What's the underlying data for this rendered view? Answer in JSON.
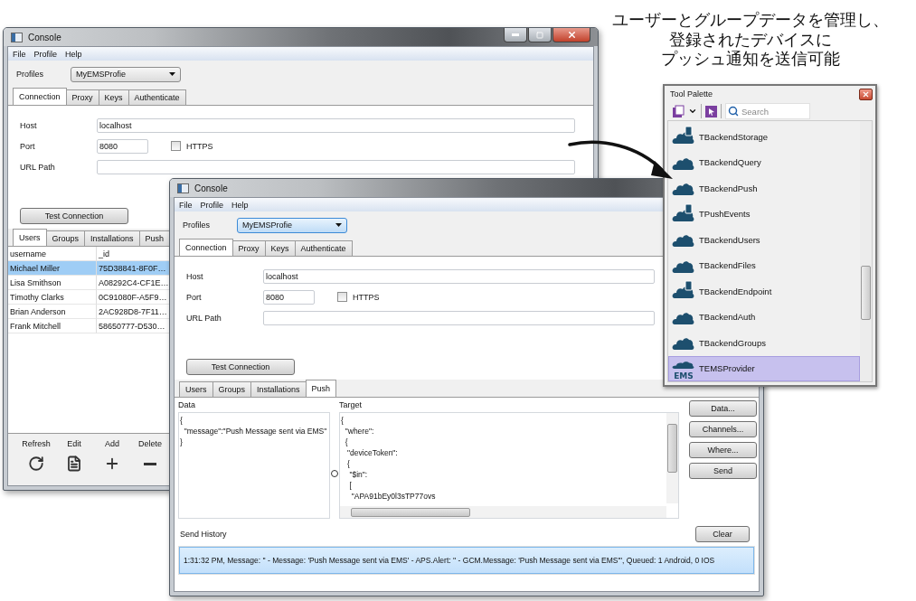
{
  "annotation": {
    "lines": [
      "ユーザーとグループデータを管理し、",
      "登録されたデバイスに",
      "プッシュ通知を送信可能"
    ]
  },
  "back_window": {
    "title": "Console",
    "menu": [
      "File",
      "Profile",
      "Help"
    ],
    "profiles": {
      "label": "Profiles",
      "value": "MyEMSProfie"
    },
    "tabs": [
      {
        "label": "Connection",
        "selected": true
      },
      {
        "label": "Proxy",
        "selected": false
      },
      {
        "label": "Keys",
        "selected": false
      },
      {
        "label": "Authenticate",
        "selected": false
      }
    ],
    "host": {
      "label": "Host",
      "value": "localhost"
    },
    "port": {
      "label": "Port",
      "value": "8080"
    },
    "https": {
      "label": "HTTPS",
      "checked": false
    },
    "url_path": {
      "label": "URL Path"
    },
    "test_button": "Test Connection",
    "data_tabs": [
      {
        "label": "Users",
        "selected": true
      },
      {
        "label": "Groups",
        "selected": false
      },
      {
        "label": "Installations",
        "selected": false
      },
      {
        "label": "Push",
        "selected": false
      }
    ],
    "table": {
      "columns": [
        "username",
        "_id"
      ],
      "rows": [
        {
          "cells": [
            "Michael Miller",
            "75D38841-8F0F…"
          ],
          "selected": true
        },
        {
          "cells": [
            "Lisa Smithson",
            "A08292C4-CF1E…"
          ],
          "selected": false
        },
        {
          "cells": [
            "Timothy Clarks",
            "0C91080F-A5F9…"
          ],
          "selected": false
        },
        {
          "cells": [
            "Brian Anderson",
            "2AC928D8-7F11…"
          ],
          "selected": false
        },
        {
          "cells": [
            "Frank Mitchell",
            "58650777-D530…"
          ],
          "selected": false
        }
      ]
    },
    "toolbar": [
      {
        "kind": "refresh",
        "label": "Refresh"
      },
      {
        "kind": "edit",
        "label": "Edit"
      },
      {
        "kind": "add",
        "label": "Add"
      },
      {
        "kind": "delete",
        "label": "Delete"
      }
    ]
  },
  "front_window": {
    "title": "Console",
    "menu": [
      "File",
      "Profile",
      "Help"
    ],
    "profiles": {
      "label": "Profiles",
      "value": "MyEMSProfie",
      "focused": true
    },
    "tabs": [
      {
        "label": "Connection",
        "selected": true
      },
      {
        "label": "Proxy",
        "selected": false
      },
      {
        "label": "Keys",
        "selected": false
      },
      {
        "label": "Authenticate",
        "selected": false
      }
    ],
    "host": {
      "label": "Host",
      "value": "localhost"
    },
    "port": {
      "label": "Port",
      "value": "8080"
    },
    "https": {
      "label": "HTTPS",
      "checked": false
    },
    "url_path": {
      "label": "URL Path"
    },
    "test_button": "Test Connection",
    "data_tabs": [
      {
        "label": "Users",
        "selected": false
      },
      {
        "label": "Groups",
        "selected": false
      },
      {
        "label": "Installations",
        "selected": false
      },
      {
        "label": "Push",
        "selected": true
      }
    ],
    "push": {
      "data_label": "Data",
      "data_text": "{\n  \"message\":\"Push Message sent via EMS\"\n}",
      "target_label": "Target",
      "target_text": "{\n  \"where\":\n  {\n   \"deviceToken\":\n   {\n    \"$in\":\n    [\n     \"APA91bEy0l3sTP77ovs",
      "buttons": [
        "Data...",
        "Channels...",
        "Where...",
        "Send"
      ],
      "history_label": "Send History",
      "clear_button": "Clear",
      "history": [
        {
          "text": "1:31:32 PM, Message: '' - Message: 'Push Message sent via EMS' - APS.Alert: '' - GCM.Message: 'Push Message sent via EMS'\", Queued: 1 Android, 0 IOS",
          "selected": true
        }
      ]
    }
  },
  "tool_palette": {
    "title": "Tool Palette",
    "search": {
      "placeholder": "Search"
    },
    "items": [
      {
        "label": "TBackendStorage",
        "selected": false
      },
      {
        "label": "TBackendQuery",
        "selected": false
      },
      {
        "label": "TBackendPush",
        "selected": false
      },
      {
        "label": "TPushEvents",
        "selected": false
      },
      {
        "label": "TBackendUsers",
        "selected": false
      },
      {
        "label": "TBackendFiles",
        "selected": false
      },
      {
        "label": "TBackendEndpoint",
        "selected": false
      },
      {
        "label": "TBackendAuth",
        "selected": false
      },
      {
        "label": "TBackendGroups",
        "selected": false
      },
      {
        "label": "TEMSProvider",
        "selected": true,
        "icon_text": "EMS"
      }
    ]
  }
}
